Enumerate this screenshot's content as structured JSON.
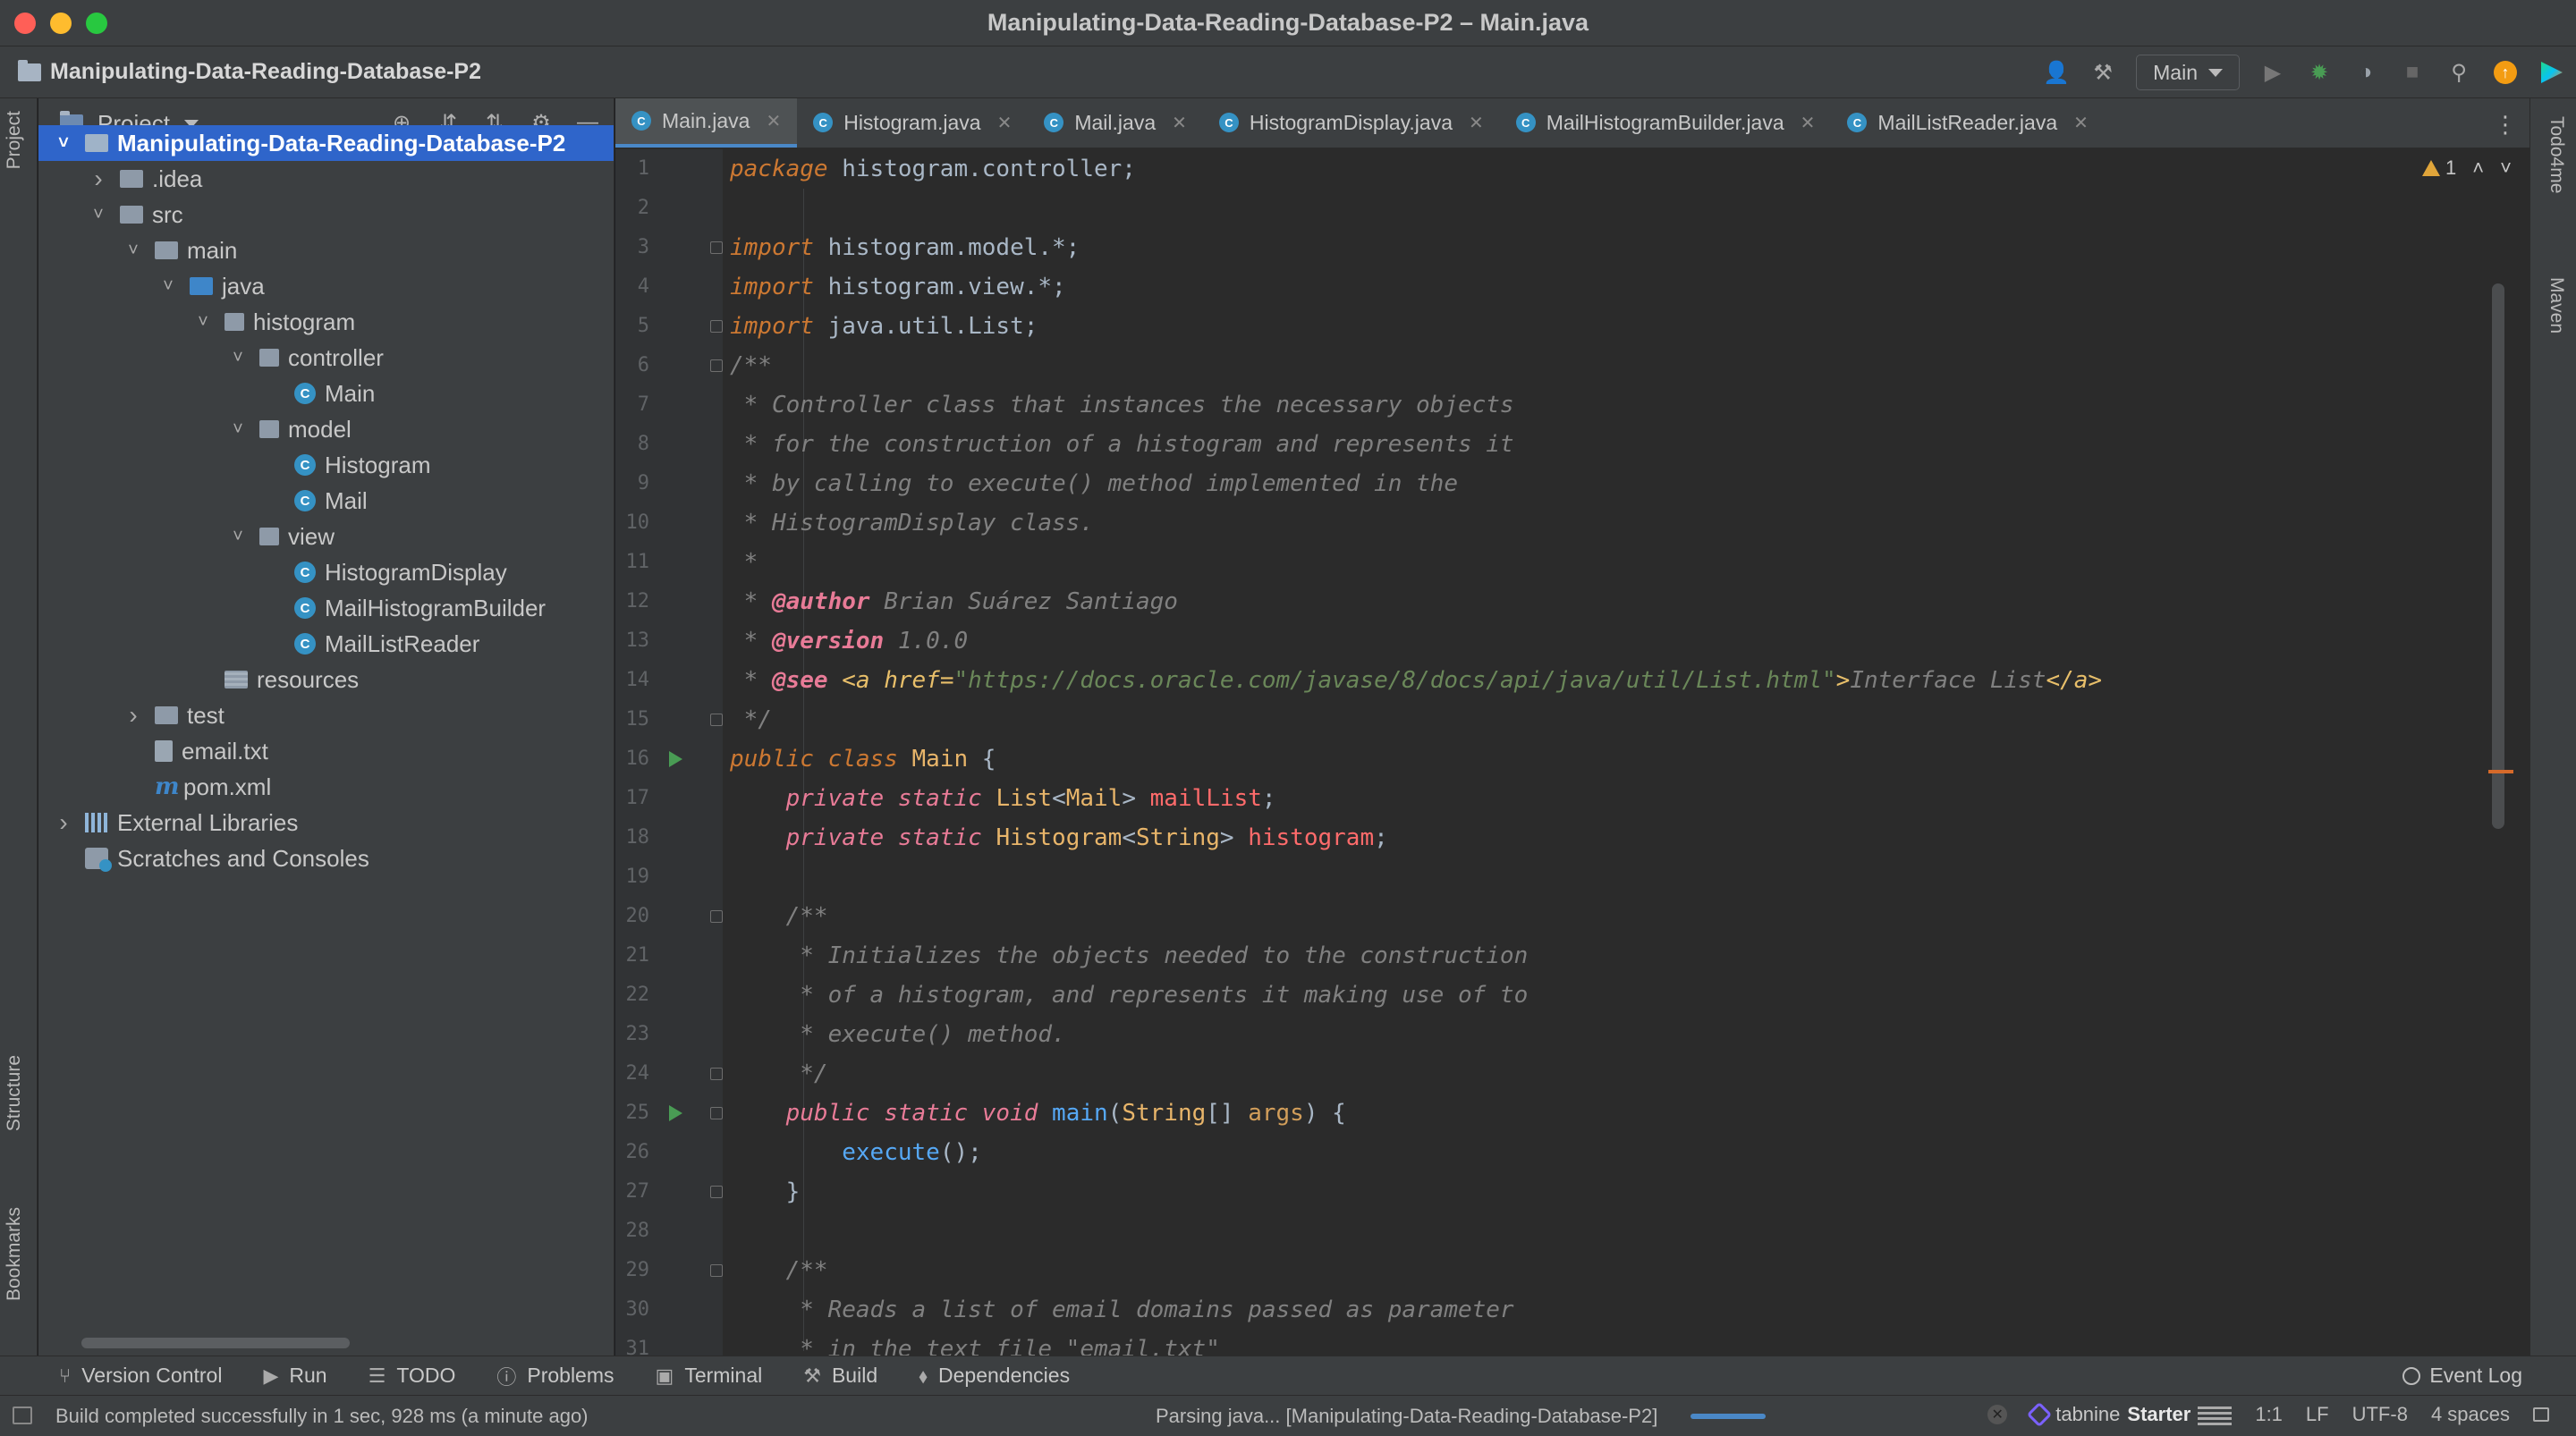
{
  "window": {
    "title": "Manipulating-Data-Reading-Database-P2 – Main.java"
  },
  "toolbar": {
    "project_name": "Manipulating-Data-Reading-Database-P2",
    "run_config": "Main",
    "icons": [
      "user-icon",
      "hammer-icon",
      "run-icon",
      "debug-icon",
      "coverage-icon",
      "stop-icon",
      "search-icon",
      "update-icon",
      "toolbox-icon"
    ]
  },
  "left_strip": {
    "project": "Project",
    "structure": "Structure",
    "bookmarks": "Bookmarks"
  },
  "right_strip": {
    "todo": "Todo4me",
    "maven": "Maven"
  },
  "project_panel": {
    "title": "Project",
    "tree": [
      {
        "label": "Manipulating-Data-Reading-Database-P2",
        "icon": "module-folder",
        "arrow": "expanded",
        "level": 0,
        "selected": true
      },
      {
        "label": ".idea",
        "icon": "folder",
        "arrow": "collapsed",
        "level": 1
      },
      {
        "label": "src",
        "icon": "folder",
        "arrow": "expanded",
        "level": 1
      },
      {
        "label": "main",
        "icon": "folder",
        "arrow": "expanded",
        "level": 2
      },
      {
        "label": "java",
        "icon": "source-folder",
        "arrow": "expanded",
        "level": 3
      },
      {
        "label": "histogram",
        "icon": "package",
        "arrow": "expanded",
        "level": 4
      },
      {
        "label": "controller",
        "icon": "package",
        "arrow": "expanded",
        "level": 5
      },
      {
        "label": "Main",
        "icon": "class",
        "arrow": "none",
        "level": 6
      },
      {
        "label": "model",
        "icon": "package",
        "arrow": "expanded",
        "level": 5
      },
      {
        "label": "Histogram",
        "icon": "class",
        "arrow": "none",
        "level": 6
      },
      {
        "label": "Mail",
        "icon": "class",
        "arrow": "none",
        "level": 6
      },
      {
        "label": "view",
        "icon": "package",
        "arrow": "expanded",
        "level": 5
      },
      {
        "label": "HistogramDisplay",
        "icon": "class",
        "arrow": "none",
        "level": 6
      },
      {
        "label": "MailHistogramBuilder",
        "icon": "class",
        "arrow": "none",
        "level": 6
      },
      {
        "label": "MailListReader",
        "icon": "class",
        "arrow": "none",
        "level": 6
      },
      {
        "label": "resources",
        "icon": "resources-folder",
        "arrow": "none",
        "level": 4
      },
      {
        "label": "test",
        "icon": "folder",
        "arrow": "collapsed",
        "level": 2
      },
      {
        "label": "email.txt",
        "icon": "file",
        "arrow": "none",
        "level": 2
      },
      {
        "label": "pom.xml",
        "icon": "maven",
        "arrow": "none",
        "level": 2
      },
      {
        "label": "External Libraries",
        "icon": "library",
        "arrow": "collapsed",
        "level": 0
      },
      {
        "label": "Scratches and Consoles",
        "icon": "scratch",
        "arrow": "none",
        "level": 0
      }
    ]
  },
  "editor": {
    "tabs": [
      {
        "label": "Main.java",
        "active": true
      },
      {
        "label": "Histogram.java",
        "active": false
      },
      {
        "label": "Mail.java",
        "active": false
      },
      {
        "label": "HistogramDisplay.java",
        "active": false
      },
      {
        "label": "MailHistogramBuilder.java",
        "active": false
      },
      {
        "label": "MailListReader.java",
        "active": false
      }
    ],
    "inspection_count": "1",
    "run_gutter_lines": [
      16,
      25
    ],
    "fold_lines": [
      3,
      5,
      6,
      15,
      20,
      24,
      25,
      27,
      29
    ],
    "lines": [
      [
        [
          "kw",
          "package"
        ],
        [
          "id",
          " histogram.controller;"
        ]
      ],
      [],
      [
        [
          "kw",
          "import"
        ],
        [
          "id",
          " histogram.model.*;"
        ]
      ],
      [
        [
          "kw",
          "import"
        ],
        [
          "id",
          " histogram.view.*;"
        ]
      ],
      [
        [
          "kw",
          "import"
        ],
        [
          "id",
          " java.util.List;"
        ]
      ],
      [
        [
          "cm",
          "/**"
        ]
      ],
      [
        [
          "cm",
          " * Controller class that instances the necessary objects"
        ]
      ],
      [
        [
          "cm",
          " * for the construction of a histogram and represents it"
        ]
      ],
      [
        [
          "cm",
          " * by calling to execute() method implemented in the"
        ]
      ],
      [
        [
          "cm",
          " * HistogramDisplay class."
        ]
      ],
      [
        [
          "cm",
          " *"
        ]
      ],
      [
        [
          "cm",
          " * "
        ],
        [
          "tag",
          "@author"
        ],
        [
          "cm",
          " Brian Suárez Santiago"
        ]
      ],
      [
        [
          "cm",
          " * "
        ],
        [
          "tag",
          "@version"
        ],
        [
          "cm",
          " 1.0.0"
        ]
      ],
      [
        [
          "cm",
          " * "
        ],
        [
          "tag",
          "@see"
        ],
        [
          "cm",
          " "
        ],
        [
          "htm",
          "<a href="
        ],
        [
          "lnk",
          "\"https://docs.oracle.com/javase/8/docs/api/java/util/List.html\""
        ],
        [
          "htm",
          ">"
        ],
        [
          "cm",
          "Interface List"
        ],
        [
          "htm",
          "</a>"
        ]
      ],
      [
        [
          "cm",
          " */"
        ]
      ],
      [
        [
          "kw",
          "public class"
        ],
        [
          "id",
          " "
        ],
        [
          "ty",
          "Main"
        ],
        [
          "id",
          " {"
        ]
      ],
      [
        [
          "id",
          "    "
        ],
        [
          "kw2",
          "private static"
        ],
        [
          "id",
          " "
        ],
        [
          "ty",
          "List"
        ],
        [
          "id",
          "<"
        ],
        [
          "ty",
          "Mail"
        ],
        [
          "id",
          "> "
        ],
        [
          "fld",
          "mailList"
        ],
        [
          "id",
          ";"
        ]
      ],
      [
        [
          "id",
          "    "
        ],
        [
          "kw2",
          "private static"
        ],
        [
          "id",
          " "
        ],
        [
          "ty",
          "Histogram"
        ],
        [
          "id",
          "<"
        ],
        [
          "ty",
          "String"
        ],
        [
          "id",
          "> "
        ],
        [
          "fld",
          "histogram"
        ],
        [
          "id",
          ";"
        ]
      ],
      [],
      [
        [
          "cm",
          "    /**"
        ]
      ],
      [
        [
          "cm",
          "     * Initializes the objects needed to the construction"
        ]
      ],
      [
        [
          "cm",
          "     * of a histogram, and represents it making use of to"
        ]
      ],
      [
        [
          "cm",
          "     * execute() method."
        ]
      ],
      [
        [
          "cm",
          "     */"
        ]
      ],
      [
        [
          "id",
          "    "
        ],
        [
          "kw2",
          "public static void"
        ],
        [
          "id",
          " "
        ],
        [
          "mth",
          "main"
        ],
        [
          "id",
          "("
        ],
        [
          "ty",
          "String"
        ],
        [
          "id",
          "[] "
        ],
        [
          "prm",
          "args"
        ],
        [
          "id",
          ") {"
        ]
      ],
      [
        [
          "id",
          "        "
        ],
        [
          "mth",
          "execute"
        ],
        [
          "id",
          "();"
        ]
      ],
      [
        [
          "id",
          "    }"
        ]
      ],
      [],
      [
        [
          "cm",
          "    /**"
        ]
      ],
      [
        [
          "cm",
          "     * Reads a list of email domains passed as parameter"
        ]
      ],
      [
        [
          "cm",
          "     * in the text file \"email.txt\""
        ]
      ]
    ]
  },
  "toolwindows": [
    {
      "label": "Version Control",
      "icon": "branch-icon"
    },
    {
      "label": "Run",
      "icon": "play-icon"
    },
    {
      "label": "TODO",
      "icon": "list-icon"
    },
    {
      "label": "Problems",
      "icon": "info-icon"
    },
    {
      "label": "Terminal",
      "icon": "terminal-icon"
    },
    {
      "label": "Build",
      "icon": "hammer-icon"
    },
    {
      "label": "Dependencies",
      "icon": "layers-icon"
    }
  ],
  "event_log": "Event Log",
  "statusbar": {
    "message": "Build completed successfully in 1 sec, 928 ms (a minute ago)",
    "parsing": "Parsing java... [Manipulating-Data-Reading-Database-P2]",
    "tabnine_brand": "tabnine",
    "tabnine_plan": "Starter",
    "position": "1:1",
    "line_sep": "LF",
    "encoding": "UTF-8",
    "indent": "4 spaces",
    "progress": 0.35
  }
}
